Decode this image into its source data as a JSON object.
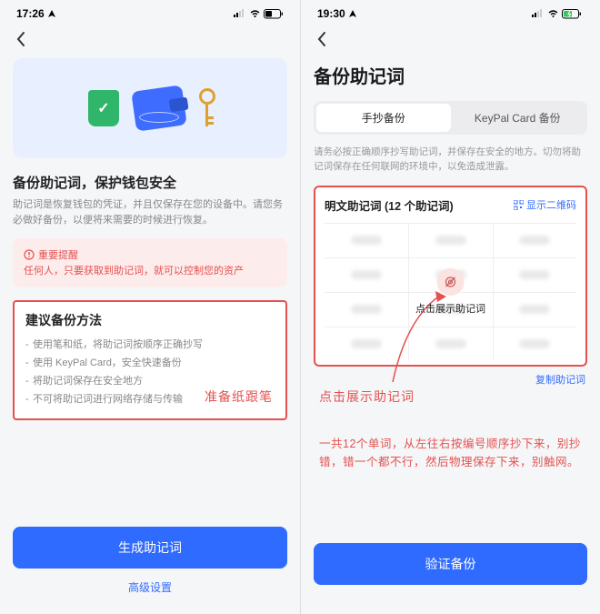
{
  "left": {
    "statusbar": {
      "time": "17:26"
    },
    "heading": "备份助记词，保护钱包安全",
    "description": "助记词是恢复钱包的凭证，并且仅保存在您的设备中。请您务必做好备份，以便将来需要的时候进行恢复。",
    "alert": {
      "title": "重要提醒",
      "text": "任何人，只要获取到助记词，就可以控制您的资产"
    },
    "methods": {
      "heading": "建议备份方法",
      "items": [
        "使用笔和纸，将助记词按顺序正确抄写",
        "使用 KeyPal Card，安全快速备份",
        "将助记词保存在安全地方",
        "不可将助记词进行网络存储与传输"
      ]
    },
    "annotation": "准备纸跟笔",
    "actions": {
      "primary": "生成助记词",
      "secondary": "高级设置"
    }
  },
  "right": {
    "statusbar": {
      "time": "19:30"
    },
    "page_title": "备份助记词",
    "tabs": {
      "manual": "手抄备份",
      "keypal": "KeyPal Card 备份"
    },
    "warning_text": "请务必按正确顺序抄写助记词，并保存在安全的地方。切勿将助记词保存在任何联网的环境中，以免造成泄露。",
    "mnemonic": {
      "title": "明文助记词 (12 个助记词)",
      "qr_link": "显示二维码",
      "overlay_text": "点击展示助记词",
      "copy_link": "复制助记词"
    },
    "notes": {
      "a": "点击展示助记词",
      "b": "一共12个单词，从左往右按编号顺序抄下来，别抄错，错一个都不行，然后物理保存下来，别触网。"
    },
    "actions": {
      "primary": "验证备份"
    }
  }
}
